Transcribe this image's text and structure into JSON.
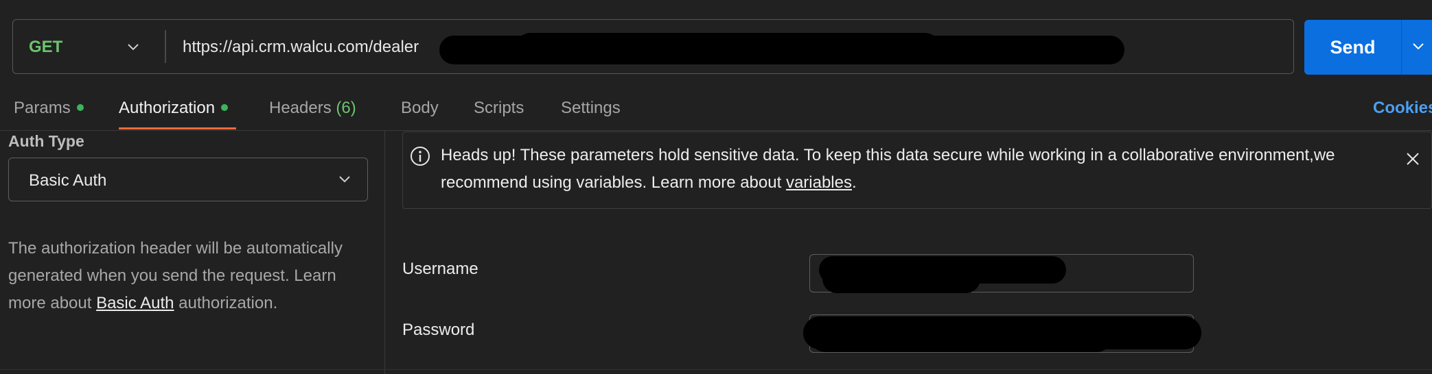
{
  "request": {
    "method": "GET",
    "url": "https://api.crm.walcu.com/dealer",
    "send_label": "Send"
  },
  "tabs": [
    {
      "label": "Params",
      "has_dot": true
    },
    {
      "label": "Authorization",
      "has_dot": true,
      "active": true
    },
    {
      "label": "Headers",
      "count": "(6)"
    },
    {
      "label": "Body"
    },
    {
      "label": "Scripts"
    },
    {
      "label": "Settings"
    }
  ],
  "cookies_label": "Cookies",
  "auth": {
    "type_label": "Auth Type",
    "selected": "Basic Auth",
    "desc_before": "The authorization header will be automatically generated when you send the request. Learn more about ",
    "desc_link": "Basic Auth",
    "desc_after": " authorization."
  },
  "alert": {
    "text_before": "Heads up! These parameters hold sensitive data. To keep this data secure while working in a collaborative environment,we recommend using variables. Learn more about ",
    "link": "variables",
    "text_after": "."
  },
  "fields": {
    "username_label": "Username",
    "password_label": "Password"
  },
  "colors": {
    "accent": "#0b6fe0",
    "method_green": "#6cc46e",
    "tab_underline": "#f26b3a",
    "cookies_blue": "#4c9ff0",
    "dot_green": "#3bb55a"
  }
}
